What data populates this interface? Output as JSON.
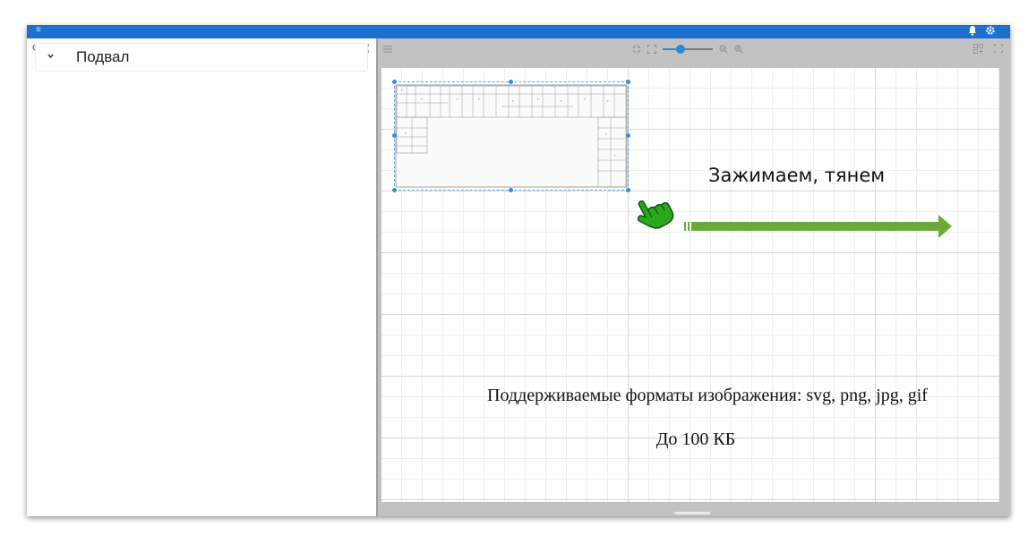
{
  "header": {
    "icons": [
      "menu-icon",
      "bell-icon",
      "gear-icon"
    ],
    "brand_color": "#1e6fd0"
  },
  "left_panel": {
    "tree": [
      {
        "label": "Подвал",
        "expanded": true
      }
    ],
    "tool_icons": [
      "search-icon",
      "add-layer-icon",
      "fullscreen-icon"
    ]
  },
  "right_panel": {
    "toolbar_icons": [
      "menu-icon",
      "fit-icon",
      "expand-icon",
      "zoom-out-icon",
      "zoom-in-icon",
      "add-layer-icon",
      "fullscreen-icon"
    ],
    "zoom_level": 0.35,
    "accent_color": "#2a87d8"
  },
  "canvas": {
    "instruction": "Зажимаем, тянем",
    "formats_note": "Поддерживаемые форматы изображения: svg, png, jpg, gif",
    "size_note": "До 100 КБ",
    "arrow_color": "#6aaa3a",
    "hand_color": "#22a318"
  }
}
